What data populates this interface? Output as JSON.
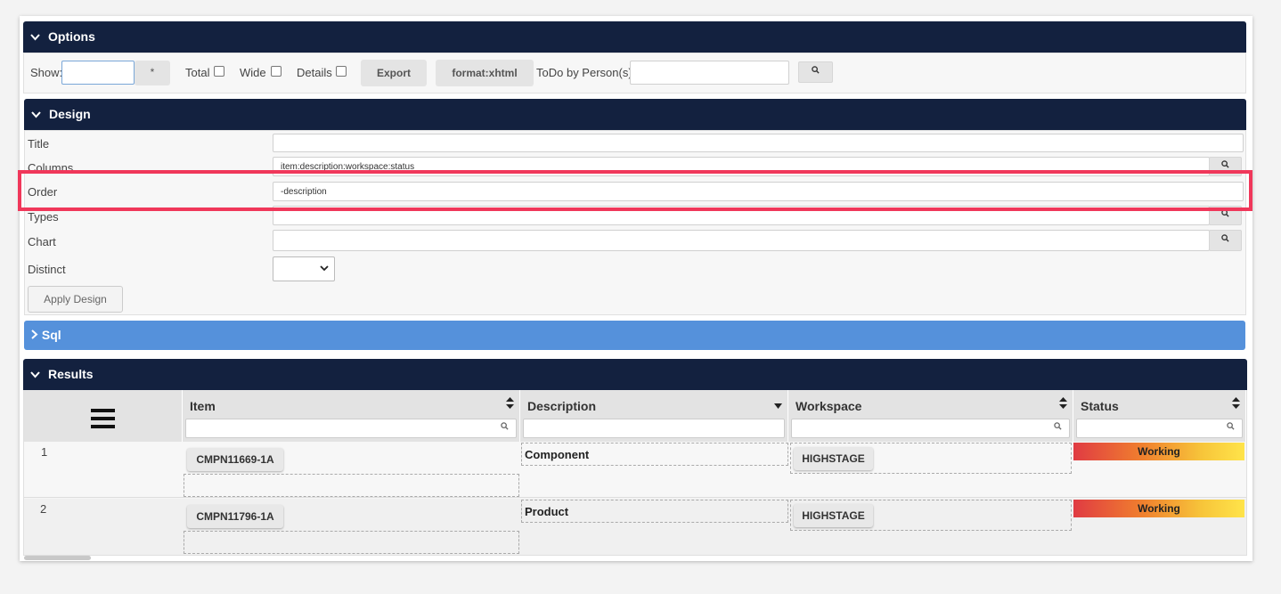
{
  "options": {
    "header": "Options",
    "show_label": "Show:",
    "star_label": "*",
    "total_label": "Total",
    "wide_label": "Wide",
    "details_label": "Details",
    "export_label": "Export",
    "format_label": "format:xhtml",
    "todo_label": "ToDo by Person(s)",
    "show_value": "",
    "todo_value": ""
  },
  "design": {
    "header": "Design",
    "title_label": "Title",
    "title_value": "",
    "columns_label": "Columns",
    "columns_value": "item:description:workspace:status",
    "order_label": "Order",
    "order_value": "-description",
    "types_label": "Types",
    "types_value": "",
    "chart_label": "Chart",
    "chart_value": "",
    "distinct_label": "Distinct",
    "distinct_value": "",
    "apply_label": "Apply Design"
  },
  "sql": {
    "header": "Sql"
  },
  "results": {
    "header": "Results",
    "columns": [
      "Item",
      "Description",
      "Workspace",
      "Status"
    ],
    "rows": [
      {
        "num": "1",
        "item": "CMPN11669-1A",
        "description": "Component",
        "workspace": "HIGHSTAGE",
        "status": "Working"
      },
      {
        "num": "2",
        "item": "CMPN11796-1A",
        "description": "Product",
        "workspace": "HIGHSTAGE",
        "status": "Working"
      }
    ]
  },
  "colors": {
    "navy_header": "#13213f",
    "sql_blue": "#5591db",
    "highlight_red": "#f0375a"
  }
}
